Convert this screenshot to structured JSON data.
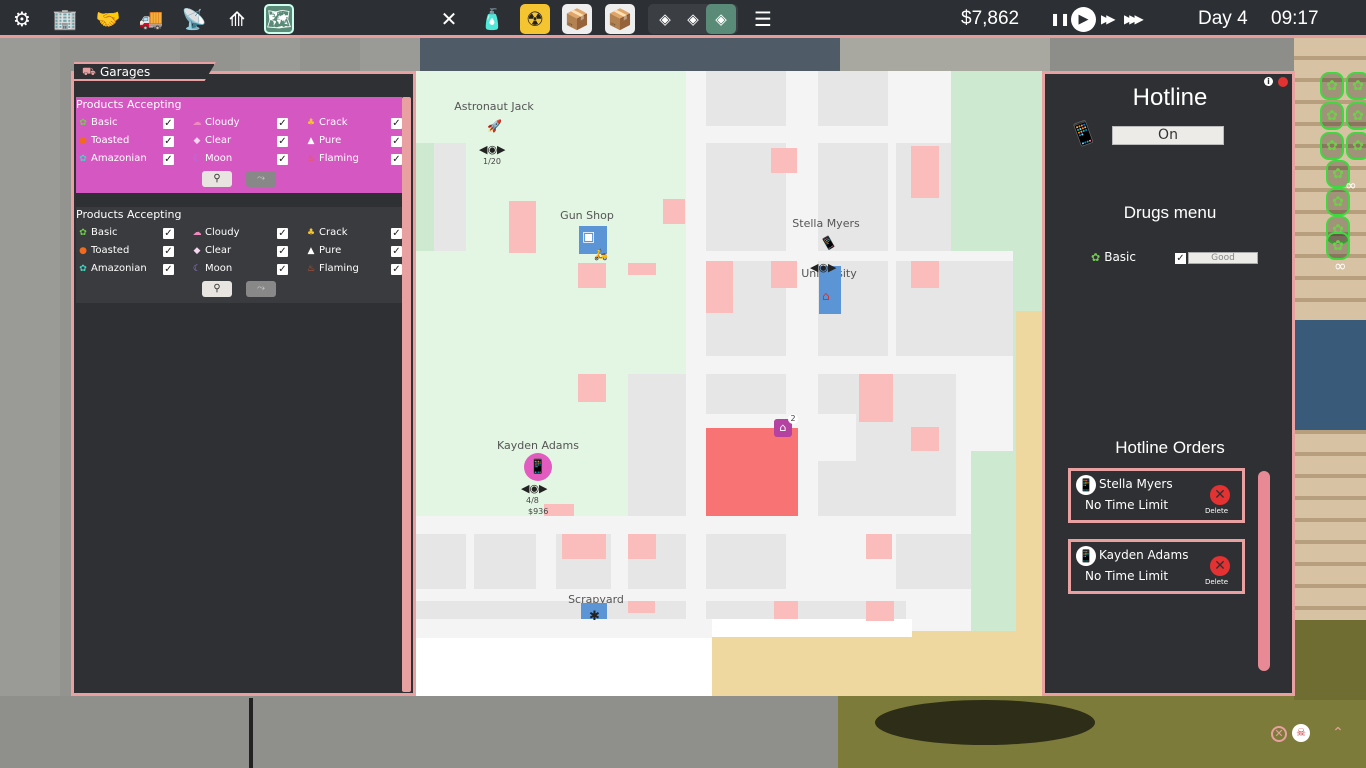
{
  "topbar": {
    "tools": [
      {
        "icon": "gear-icon",
        "glyph": "⚙"
      },
      {
        "icon": "buildings-icon",
        "glyph": "🏢"
      },
      {
        "icon": "handshake-icon",
        "glyph": "🤝"
      },
      {
        "icon": "delivery-truck-icon",
        "glyph": "🚚"
      },
      {
        "icon": "radio-tower-icon",
        "glyph": "📡"
      },
      {
        "icon": "network-icon",
        "glyph": "⟰"
      },
      {
        "icon": "map-icon",
        "glyph": "🗺"
      }
    ],
    "mid_tools": [
      {
        "icon": "cutlery-icon",
        "glyph": "✕"
      },
      {
        "icon": "bottle-icon",
        "glyph": "🧴"
      },
      {
        "icon": "radiation-icon",
        "glyph": "☢"
      },
      {
        "icon": "package-icon",
        "glyph": "📦"
      },
      {
        "icon": "boxes-icon",
        "glyph": "📦"
      },
      {
        "icon": "cube-icon-1",
        "glyph": "◈"
      },
      {
        "icon": "cube-icon-2",
        "glyph": "◈"
      },
      {
        "icon": "cube-icon-3",
        "glyph": "◈"
      },
      {
        "icon": "stack-icon",
        "glyph": "☰"
      }
    ],
    "money": "$7,862",
    "day": "Day 4",
    "time": "09:17",
    "pause_glyph": "❚❚",
    "play_glyph": "▶",
    "fast_glyph": "▶▶",
    "faster_glyph": "▶▶▶"
  },
  "garages": {
    "title": "Garages",
    "title_icon": "⛟",
    "blocks": [
      {
        "header": "Products Accepting",
        "products": [
          {
            "name": "Basic",
            "icon": "leaf-icon",
            "glyph": "✿",
            "color": "#6fcf4a",
            "checked": true
          },
          {
            "name": "Cloudy",
            "icon": "cloud-icon",
            "glyph": "☁",
            "color": "#f08ac0",
            "checked": true
          },
          {
            "name": "Crack",
            "icon": "crack-icon",
            "glyph": "♣",
            "color": "#f5c431",
            "checked": true
          },
          {
            "name": "Toasted",
            "icon": "toasted-icon",
            "glyph": "●",
            "color": "#f26b1d",
            "checked": true
          },
          {
            "name": "Clear",
            "icon": "diamond-icon",
            "glyph": "◆",
            "color": "#f5d6f0",
            "checked": true
          },
          {
            "name": "Pure",
            "icon": "pure-icon",
            "glyph": "▲",
            "color": "#ffffff",
            "checked": true
          },
          {
            "name": "Amazonian",
            "icon": "amazonian-icon",
            "glyph": "✿",
            "color": "#3fd8c4",
            "checked": true
          },
          {
            "name": "Moon",
            "icon": "moon-icon",
            "glyph": "☾",
            "color": "#9a7cf0",
            "checked": true
          },
          {
            "name": "Flaming",
            "icon": "flame-icon",
            "glyph": "♨",
            "color": "#f25a2a",
            "checked": true
          }
        ],
        "button1_glyph": "⚲",
        "button2_glyph": "⤳"
      },
      {
        "header": "Products Accepting",
        "products": [
          {
            "name": "Basic",
            "icon": "leaf-icon",
            "glyph": "✿",
            "color": "#6fcf4a",
            "checked": true
          },
          {
            "name": "Cloudy",
            "icon": "cloud-icon",
            "glyph": "☁",
            "color": "#f08ac0",
            "checked": true
          },
          {
            "name": "Crack",
            "icon": "crack-icon",
            "glyph": "♣",
            "color": "#f5c431",
            "checked": true
          },
          {
            "name": "Toasted",
            "icon": "toasted-icon",
            "glyph": "●",
            "color": "#f26b1d",
            "checked": true
          },
          {
            "name": "Clear",
            "icon": "diamond-icon",
            "glyph": "◆",
            "color": "#f5d6f0",
            "checked": true
          },
          {
            "name": "Pure",
            "icon": "pure-icon",
            "glyph": "▲",
            "color": "#ffffff",
            "checked": true
          },
          {
            "name": "Amazonian",
            "icon": "amazonian-icon",
            "glyph": "✿",
            "color": "#3fd8c4",
            "checked": true
          },
          {
            "name": "Moon",
            "icon": "moon-icon",
            "glyph": "☾",
            "color": "#9a7cf0",
            "checked": true
          },
          {
            "name": "Flaming",
            "icon": "flame-icon",
            "glyph": "♨",
            "color": "#f25a2a",
            "checked": true
          }
        ],
        "button1_glyph": "⚲",
        "button2_glyph": "⤳"
      }
    ]
  },
  "map": {
    "labels": {
      "astronaut": "Astronaut Jack",
      "gun_shop": "Gun Shop",
      "stella": "Stella Myers",
      "university": "University",
      "kayden": "Kayden Adams",
      "scrapyard": "Scrapyard"
    },
    "astronaut_count": "1/20",
    "kayden_count": "4/8",
    "kayden_money": "$936",
    "house_badge": "2",
    "check_glyph": "✓"
  },
  "hotline": {
    "title": "Hotline",
    "toggle_label": "On",
    "drugs_menu_title": "Drugs menu",
    "drug": {
      "name": "Basic",
      "quality": "Good",
      "checked": true
    },
    "orders_title": "Hotline Orders",
    "orders": [
      {
        "name": "Stella Myers",
        "time_limit": "No Time Limit",
        "delete_label": "Delete"
      },
      {
        "name": "Kayden Adams",
        "time_limit": "No Time Limit",
        "delete_label": "Delete"
      }
    ]
  },
  "inventory": {
    "leaf_glyph": "✿",
    "infinity_glyph": "∞",
    "color": "#3fd83f"
  },
  "colors": {
    "accent_pink": "#e8a0a0",
    "panel_bg": "#2f3033",
    "garage_highlight": "#d557c1",
    "map_red": "#fbbcbc"
  }
}
